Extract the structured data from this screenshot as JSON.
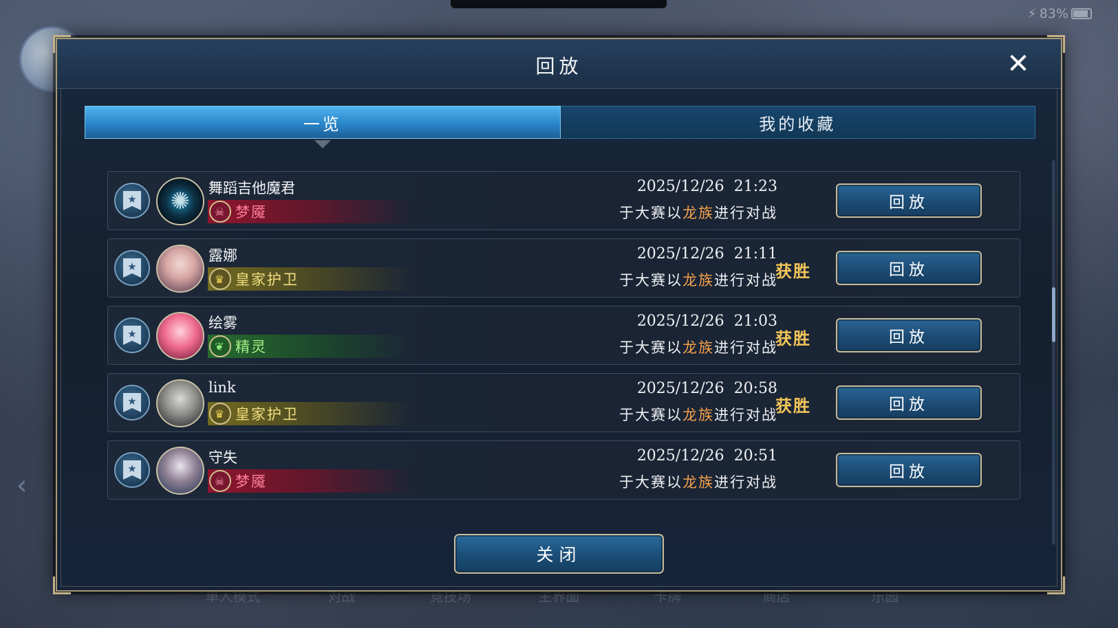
{
  "status": {
    "battery": "83%"
  },
  "bottom_nav": [
    "单人模式",
    "对战",
    "竞技场",
    "主界面",
    "卡牌",
    "商店",
    "乐园"
  ],
  "dialog": {
    "title": "回放",
    "close_icon": "close-icon",
    "tabs": [
      {
        "label": "一览",
        "active": true
      },
      {
        "label": "我的收藏",
        "active": false
      }
    ],
    "close_label": "关闭"
  },
  "records": [
    {
      "name": "舞蹈吉他魔君",
      "class": "梦魇",
      "class_color": "red",
      "class_icon": "nightmare-icon",
      "datetime": "2025/12/26  21:23",
      "desc_prefix": "于大赛以",
      "desc_highlight": "龙族",
      "desc_suffix": "进行对战",
      "result": "",
      "replay_label": "回放"
    },
    {
      "name": "露娜",
      "class": "皇家护卫",
      "class_color": "gold",
      "class_icon": "crown-icon",
      "datetime": "2025/12/26  21:11",
      "desc_prefix": "于大赛以",
      "desc_highlight": "龙族",
      "desc_suffix": "进行对战",
      "result": "获胜",
      "replay_label": "回放"
    },
    {
      "name": "绘雾",
      "class": "精灵",
      "class_color": "green",
      "class_icon": "leaf-icon",
      "datetime": "2025/12/26  21:03",
      "desc_prefix": "于大赛以",
      "desc_highlight": "龙族",
      "desc_suffix": "进行对战",
      "result": "获胜",
      "replay_label": "回放"
    },
    {
      "name": "link",
      "class": "皇家护卫",
      "class_color": "gold",
      "class_icon": "crown-icon",
      "datetime": "2025/12/26  20:58",
      "desc_prefix": "于大赛以",
      "desc_highlight": "龙族",
      "desc_suffix": "进行对战",
      "result": "获胜",
      "replay_label": "回放"
    },
    {
      "name": "守失",
      "class": "梦魇",
      "class_color": "red",
      "class_icon": "nightmare-icon",
      "datetime": "2025/12/26  20:51",
      "desc_prefix": "于大赛以",
      "desc_highlight": "龙族",
      "desc_suffix": "进行对战",
      "result": "",
      "replay_label": "回放"
    }
  ]
}
